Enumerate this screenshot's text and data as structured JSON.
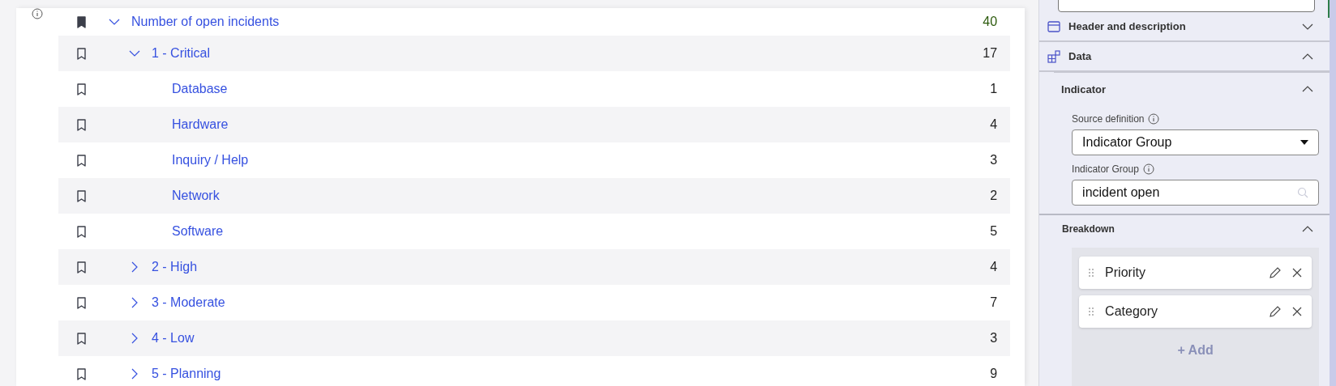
{
  "tree": [
    {
      "label": "Number of open incidents",
      "value": "40",
      "bookmarked": true,
      "expanded": true,
      "children": [
        {
          "label": "1 - Critical",
          "value": "17",
          "bookmarked": false,
          "expanded": true,
          "children": [
            {
              "label": "Database",
              "value": "1",
              "bookmarked": false
            },
            {
              "label": "Hardware",
              "value": "4",
              "bookmarked": false
            },
            {
              "label": "Inquiry / Help",
              "value": "3",
              "bookmarked": false
            },
            {
              "label": "Network",
              "value": "2",
              "bookmarked": false
            },
            {
              "label": "Software",
              "value": "5",
              "bookmarked": false
            }
          ]
        },
        {
          "label": "2 - High",
          "value": "4",
          "bookmarked": false,
          "expanded": false
        },
        {
          "label": "3 - Moderate",
          "value": "7",
          "bookmarked": false,
          "expanded": false
        },
        {
          "label": "4 - Low",
          "value": "3",
          "bookmarked": false,
          "expanded": false
        },
        {
          "label": "5 - Planning",
          "value": "9",
          "bookmarked": false,
          "expanded": false
        }
      ]
    }
  ],
  "panel": {
    "sections": [
      {
        "title": "Header and description",
        "kind": "header",
        "expanded": false
      },
      {
        "title": "Data",
        "kind": "data",
        "expanded": true
      }
    ],
    "indicator": {
      "title": "Indicator",
      "expanded": true,
      "source_label": "Source definition",
      "source_value": "Indicator Group",
      "group_label": "Indicator Group",
      "group_value": "incident open"
    },
    "breakdown": {
      "title": "Breakdown",
      "expanded": true,
      "items": [
        "Priority",
        "Category"
      ],
      "add": "+ Add"
    }
  }
}
